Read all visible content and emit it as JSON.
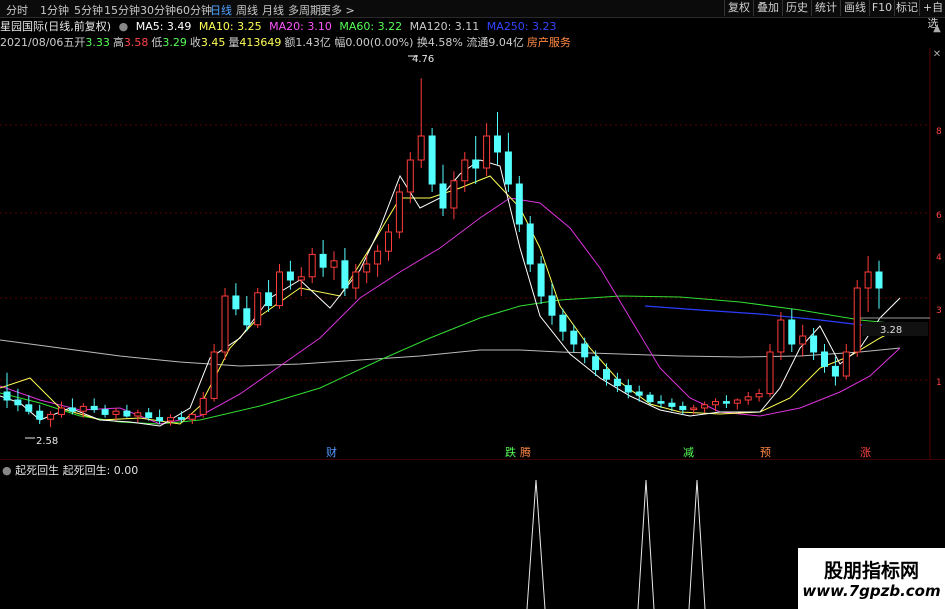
{
  "tabs": {
    "t1": "分时",
    "t2": "1分钟",
    "t3": "5分钟",
    "t4": "15分钟",
    "t5": "30分钟",
    "t6": "60分钟",
    "t7": "日线",
    "t8": "周线",
    "t9": "月线",
    "t10": "多周期",
    "t11": "更多 >"
  },
  "toolbar": {
    "b1": "复权",
    "b2": "叠加",
    "b3": "历史",
    "b4": "统计",
    "b5": "画线",
    "b6": "F10",
    "b7": "标记",
    "b8": "+自选"
  },
  "stock": {
    "name": "星园国际(日线,前复权)",
    "ma5": "MA5: 3.49",
    "ma10": "MA10: 3.25",
    "ma20": "MA20: 3.10",
    "ma60": "MA60: 3.22",
    "ma120": "MA120: 3.11",
    "ma250": "MA250: 3.23"
  },
  "info": {
    "date": "2021/08/06五",
    "open_l": "开",
    "open": "3.33",
    "high_l": "高",
    "high": "3.58",
    "low_l": "低",
    "low": "3.29",
    "close_l": "收",
    "close": "3.45",
    "vol_l": "量",
    "vol": "413649",
    "amt": "额1.43亿 幅0.00(0.00%) 换4.58% 流通9.04亿",
    "sector": "房产服务"
  },
  "annotations": {
    "high_price": "4.76",
    "low_price": "2.58",
    "crosshair": "3.28",
    "tag_cai": "财",
    "tag_die": "跌",
    "tag_teng": "腾",
    "tag_jian": "减",
    "tag_yu": "预",
    "tag_zhang": "涨"
  },
  "right_axis": {
    "a1": "8",
    "a2": "6",
    "a3": "4",
    "a4": "3",
    "a5": "1"
  },
  "sub_indicator": {
    "name": "起死回生",
    "value_label": "起死回生: 0.00"
  },
  "watermark": {
    "cn": "股朋指标网",
    "url": "www.7gpzb.com"
  },
  "colors": {
    "up": "#ff3b3b",
    "down": "#54ffff",
    "ma5": "#ffffff",
    "ma10": "#ffff55",
    "ma20": "#ff55ff",
    "ma60": "#55ff55",
    "ma120": "#aaaaaa",
    "ma250": "#3333ff"
  },
  "chart_data": {
    "type": "candlestick",
    "y_range": [
      2.5,
      4.9
    ],
    "ohlc": [
      [
        2.8,
        2.92,
        2.7,
        2.75
      ],
      [
        2.75,
        2.82,
        2.68,
        2.72
      ],
      [
        2.72,
        2.78,
        2.66,
        2.68
      ],
      [
        2.68,
        2.72,
        2.6,
        2.63
      ],
      [
        2.63,
        2.68,
        2.58,
        2.66
      ],
      [
        2.66,
        2.74,
        2.64,
        2.7
      ],
      [
        2.7,
        2.76,
        2.66,
        2.68
      ],
      [
        2.68,
        2.73,
        2.64,
        2.71
      ],
      [
        2.71,
        2.76,
        2.67,
        2.69
      ],
      [
        2.69,
        2.72,
        2.64,
        2.66
      ],
      [
        2.66,
        2.7,
        2.62,
        2.68
      ],
      [
        2.68,
        2.72,
        2.64,
        2.65
      ],
      [
        2.65,
        2.69,
        2.61,
        2.67
      ],
      [
        2.67,
        2.7,
        2.62,
        2.64
      ],
      [
        2.64,
        2.69,
        2.6,
        2.62
      ],
      [
        2.62,
        2.66,
        2.59,
        2.64
      ],
      [
        2.64,
        2.68,
        2.61,
        2.63
      ],
      [
        2.63,
        2.67,
        2.6,
        2.66
      ],
      [
        2.66,
        2.8,
        2.64,
        2.76
      ],
      [
        2.76,
        3.1,
        2.74,
        3.05
      ],
      [
        3.05,
        3.45,
        3.0,
        3.4
      ],
      [
        3.4,
        3.48,
        3.28,
        3.32
      ],
      [
        3.32,
        3.4,
        3.18,
        3.22
      ],
      [
        3.22,
        3.45,
        3.2,
        3.42
      ],
      [
        3.42,
        3.5,
        3.3,
        3.34
      ],
      [
        3.34,
        3.6,
        3.32,
        3.55
      ],
      [
        3.55,
        3.62,
        3.44,
        3.5
      ],
      [
        3.5,
        3.58,
        3.4,
        3.52
      ],
      [
        3.52,
        3.7,
        3.48,
        3.66
      ],
      [
        3.66,
        3.75,
        3.52,
        3.58
      ],
      [
        3.58,
        3.68,
        3.5,
        3.62
      ],
      [
        3.62,
        3.7,
        3.4,
        3.45
      ],
      [
        3.45,
        3.6,
        3.38,
        3.55
      ],
      [
        3.55,
        3.66,
        3.48,
        3.6
      ],
      [
        3.6,
        3.72,
        3.52,
        3.68
      ],
      [
        3.68,
        3.85,
        3.62,
        3.8
      ],
      [
        3.8,
        4.1,
        3.76,
        4.05
      ],
      [
        4.05,
        4.3,
        3.98,
        4.25
      ],
      [
        4.25,
        4.76,
        4.2,
        4.4
      ],
      [
        4.4,
        4.45,
        4.05,
        4.1
      ],
      [
        4.1,
        4.22,
        3.9,
        3.95
      ],
      [
        3.95,
        4.18,
        3.88,
        4.12
      ],
      [
        4.12,
        4.3,
        4.05,
        4.25
      ],
      [
        4.25,
        4.4,
        4.1,
        4.2
      ],
      [
        4.2,
        4.48,
        4.15,
        4.4
      ],
      [
        4.4,
        4.55,
        4.22,
        4.3
      ],
      [
        4.3,
        4.42,
        4.05,
        4.1
      ],
      [
        4.1,
        4.15,
        3.8,
        3.85
      ],
      [
        3.85,
        3.9,
        3.55,
        3.6
      ],
      [
        3.6,
        3.65,
        3.35,
        3.4
      ],
      [
        3.4,
        3.48,
        3.22,
        3.28
      ],
      [
        3.28,
        3.32,
        3.12,
        3.18
      ],
      [
        3.18,
        3.22,
        3.05,
        3.1
      ],
      [
        3.1,
        3.14,
        2.98,
        3.02
      ],
      [
        3.02,
        3.06,
        2.9,
        2.94
      ],
      [
        2.94,
        2.98,
        2.84,
        2.88
      ],
      [
        2.88,
        2.92,
        2.8,
        2.84
      ],
      [
        2.84,
        2.88,
        2.76,
        2.8
      ],
      [
        2.8,
        2.84,
        2.74,
        2.78
      ],
      [
        2.78,
        2.8,
        2.72,
        2.74
      ],
      [
        2.74,
        2.78,
        2.7,
        2.73
      ],
      [
        2.73,
        2.76,
        2.68,
        2.71
      ],
      [
        2.71,
        2.74,
        2.66,
        2.69
      ],
      [
        2.69,
        2.72,
        2.66,
        2.7
      ],
      [
        2.7,
        2.74,
        2.67,
        2.72
      ],
      [
        2.72,
        2.76,
        2.68,
        2.74
      ],
      [
        2.74,
        2.78,
        2.7,
        2.73
      ],
      [
        2.73,
        2.76,
        2.69,
        2.75
      ],
      [
        2.75,
        2.8,
        2.72,
        2.77
      ],
      [
        2.77,
        2.82,
        2.74,
        2.79
      ],
      [
        2.79,
        3.1,
        2.77,
        3.05
      ],
      [
        3.05,
        3.3,
        3.0,
        3.25
      ],
      [
        3.25,
        3.32,
        3.05,
        3.1
      ],
      [
        3.1,
        3.22,
        3.02,
        3.15
      ],
      [
        3.15,
        3.2,
        3.0,
        3.05
      ],
      [
        3.05,
        3.1,
        2.92,
        2.96
      ],
      [
        2.96,
        3.02,
        2.84,
        2.9
      ],
      [
        2.9,
        3.1,
        2.88,
        3.05
      ],
      [
        3.05,
        3.5,
        3.02,
        3.45
      ],
      [
        3.45,
        3.65,
        3.3,
        3.55
      ],
      [
        3.55,
        3.62,
        3.32,
        3.45
      ]
    ]
  }
}
